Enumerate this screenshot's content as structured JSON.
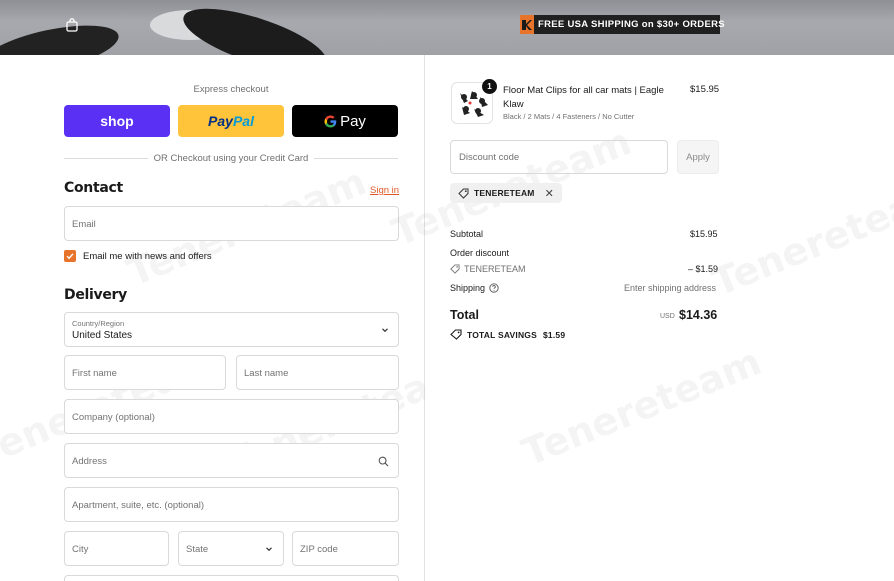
{
  "header": {
    "promo_text": "FREE USA SHIPPING on $30+ ORDERS",
    "cart_icon": "shopping-bag-icon"
  },
  "express": {
    "label": "Express checkout",
    "shop_label": "shop",
    "paypal_pay": "Pay",
    "paypal_pal": "Pal",
    "gpay_label": "Pay",
    "divider_text": "OR Checkout using your Credit Card"
  },
  "contact": {
    "title": "Contact",
    "signin_label": "Sign in",
    "email_placeholder": "Email",
    "newsletter_label": "Email me with news and offers",
    "newsletter_checked": true
  },
  "delivery": {
    "title": "Delivery",
    "country_label": "Country/Region",
    "country_value": "United States",
    "first_name_placeholder": "First name",
    "last_name_placeholder": "Last name",
    "company_placeholder": "Company (optional)",
    "address_placeholder": "Address",
    "apartment_placeholder": "Apartment, suite, etc. (optional)",
    "city_placeholder": "City",
    "state_placeholder": "State",
    "zip_placeholder": "ZIP code"
  },
  "order": {
    "item": {
      "quantity": "1",
      "name": "Floor Mat Clips for all car mats | Eagle Klaw",
      "variant": "Black / 2 Mats / 4 Fasteners / No Cutter",
      "price": "$15.95"
    },
    "discount_placeholder": "Discount code",
    "apply_label": "Apply",
    "applied_code": "TENERETEAM",
    "subtotal_label": "Subtotal",
    "subtotal_value": "$15.95",
    "order_discount_label": "Order discount",
    "discount_code": "TENERETEAM",
    "discount_value": "– $1.59",
    "shipping_label": "Shipping",
    "shipping_value": "Enter shipping address",
    "total_label": "Total",
    "total_currency": "USD",
    "total_value": "$14.36",
    "savings_label": "TOTAL SAVINGS",
    "savings_value": "$1.59"
  },
  "colors": {
    "accent": "#e8732a",
    "shop_pay": "#5a31f4",
    "paypal": "#ffc439",
    "gpay": "#000000"
  }
}
